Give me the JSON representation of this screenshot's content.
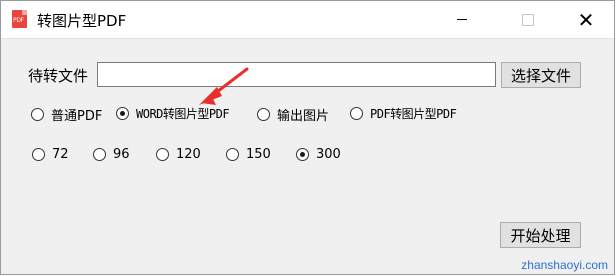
{
  "window": {
    "title": "转图片型PDF",
    "app_icon": "pdf-icon",
    "icon_text": "PDF",
    "controls": [
      "minimize-icon",
      "maximize-icon",
      "close-icon"
    ]
  },
  "file_row": {
    "label": "待转文件",
    "input_value": "",
    "choose_button": "选择文件"
  },
  "modes": [
    {
      "label": "普通PDF",
      "checked": false
    },
    {
      "label": "WORD转图片型PDF",
      "checked": true
    },
    {
      "label": "输出图片",
      "checked": false
    },
    {
      "label": "PDF转图片型PDF",
      "checked": false
    }
  ],
  "dpi_options": [
    {
      "label": "72",
      "checked": false
    },
    {
      "label": "96",
      "checked": false
    },
    {
      "label": "120",
      "checked": false
    },
    {
      "label": "150",
      "checked": false
    },
    {
      "label": "300",
      "checked": true
    }
  ],
  "start_button": "开始处理",
  "watermark": "zhanshaoyi.com",
  "colors": {
    "arrow": "#e8302a",
    "watermark": "#2f6fd6",
    "icon": "#e9453d"
  }
}
